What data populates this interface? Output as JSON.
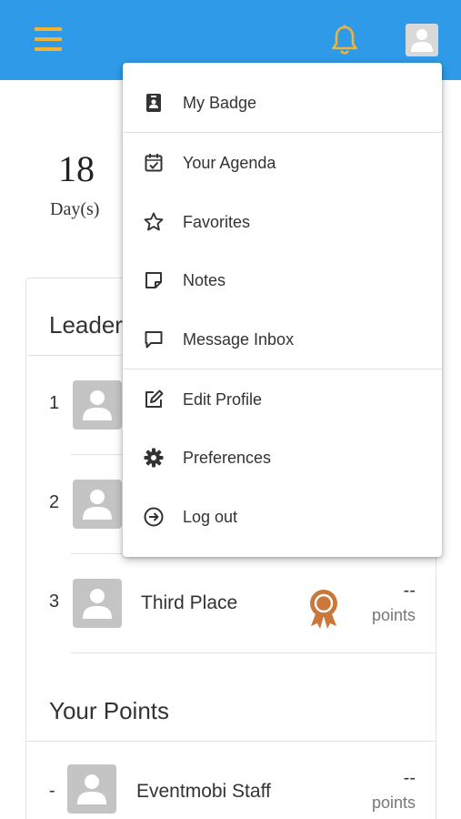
{
  "header": {
    "menu_icon": "hamburger-icon",
    "notification_icon": "bell-icon",
    "profile_icon": "user-avatar-icon",
    "accent_color": "#f2b233",
    "bar_color": "#2f9be8"
  },
  "countdown": {
    "value": "18",
    "unit": "Day(s)"
  },
  "leaderboard": {
    "title": "Leader",
    "rows": [
      {
        "rank": "1",
        "name": "",
        "points": "",
        "points_label": ""
      },
      {
        "rank": "2",
        "name": "",
        "points": "",
        "points_label": ""
      },
      {
        "rank": "3",
        "name": "Third Place",
        "points": "--",
        "points_label": "points",
        "badge": "bronze-ribbon-icon"
      }
    ]
  },
  "your_points": {
    "title": "Your Points",
    "row": {
      "rank": "-",
      "name": "Eventmobi Staff",
      "points": "--",
      "points_label": "points"
    }
  },
  "menu": {
    "items": [
      {
        "label": "My Badge",
        "icon": "badge-icon"
      },
      {
        "label": "Your Agenda",
        "icon": "calendar-check-icon"
      },
      {
        "label": "Favorites",
        "icon": "star-icon"
      },
      {
        "label": "Notes",
        "icon": "note-icon"
      },
      {
        "label": "Message Inbox",
        "icon": "chat-icon"
      },
      {
        "label": "Edit Profile",
        "icon": "edit-icon"
      },
      {
        "label": "Preferences",
        "icon": "gear-icon"
      },
      {
        "label": "Log out",
        "icon": "logout-icon"
      }
    ]
  }
}
